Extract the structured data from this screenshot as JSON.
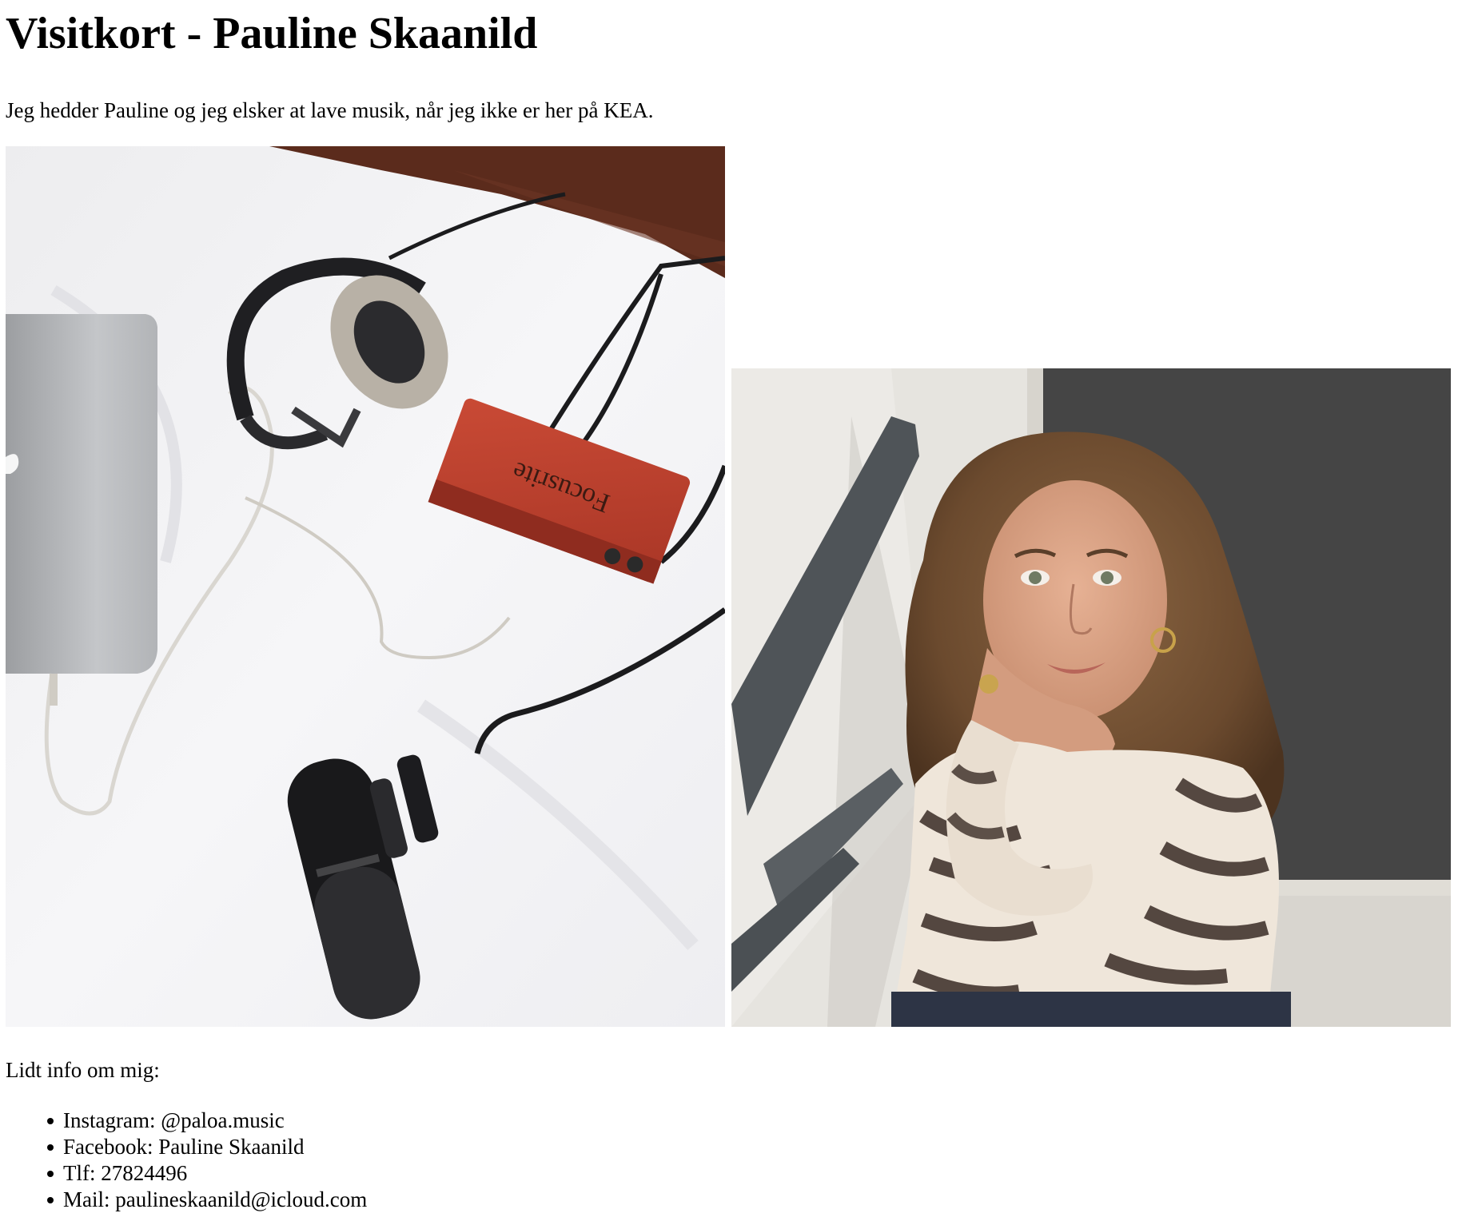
{
  "header": {
    "title": "Visitkort - Pauline Skaanild"
  },
  "intro": {
    "text": "Jeg hedder Pauline og jeg elsker at lave musik, når jeg ikke er her på KEA."
  },
  "photos": [
    {
      "subject": "music recording setup on a bed: laptop, headphones, audio interface, microphone",
      "device_logo_text": "Focusrite"
    },
    {
      "subject": "portrait of a woman with curly hair sitting on a staircase"
    }
  ],
  "info": {
    "heading": "Lidt info om mig:",
    "items": [
      {
        "label": "Instagram: @paloa.music"
      },
      {
        "label": "Facebook: Pauline Skaanild"
      },
      {
        "label": "Tlf: 27824496"
      },
      {
        "label": "Mail: paulineskaanild@icloud.com"
      }
    ]
  }
}
